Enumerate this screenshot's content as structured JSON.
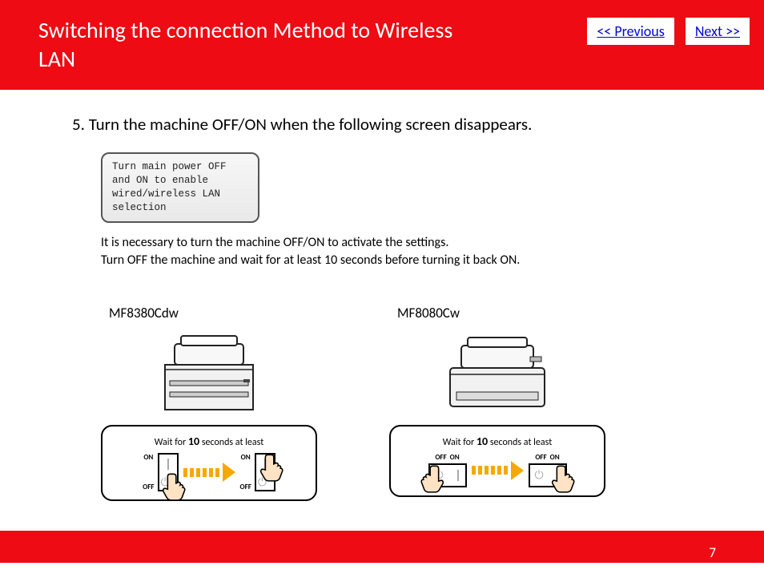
{
  "header": {
    "title": "Switching the connection Method to Wireless LAN",
    "nav": {
      "previous": "<< Previous",
      "next": "Next >>"
    }
  },
  "content": {
    "step": "5. Turn the machine OFF/ON when the following screen disappears.",
    "lcd": "Turn main power OFF\nand ON to enable\nwired/wireless LAN\nselection",
    "note_line1": "It is necessary to turn the machine OFF/ON to activate the settings.",
    "note_line2": "Turn OFF the machine and wait for at least 10 seconds before turning it back ON.",
    "model_a": "MF8380Cdw",
    "model_b": "MF8080Cw",
    "wait_pre": "Wait for ",
    "wait_num": "10",
    "wait_post": " seconds at least",
    "labels": {
      "on": "ON",
      "off": "OFF"
    }
  },
  "footer": {
    "page": "7"
  }
}
